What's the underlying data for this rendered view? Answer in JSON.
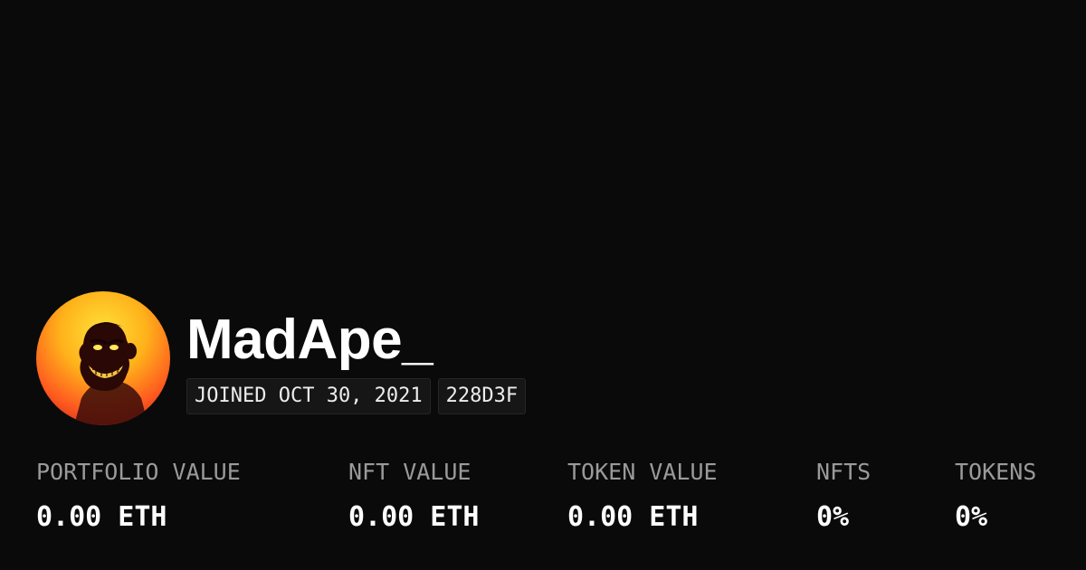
{
  "profile": {
    "username": "MadApe_",
    "joined": "JOINED OCT 30, 2021",
    "address_short": "228D3F",
    "avatar_icon": "ape-avatar-icon"
  },
  "stats": [
    {
      "label": "PORTFOLIO VALUE",
      "value": "0.00 ETH"
    },
    {
      "label": "NFT VALUE",
      "value": "0.00 ETH"
    },
    {
      "label": "TOKEN VALUE",
      "value": "0.00 ETH"
    },
    {
      "label": "NFTS",
      "value": "0%"
    },
    {
      "label": "TOKENS",
      "value": "0%"
    }
  ],
  "colors": {
    "background": "#0a0a0a",
    "text": "#ffffff",
    "label": "#9a9a9a",
    "badge_bg": "#161616",
    "avatar_gradient_top": "#ffe13a",
    "avatar_gradient_bottom": "#b81818"
  }
}
